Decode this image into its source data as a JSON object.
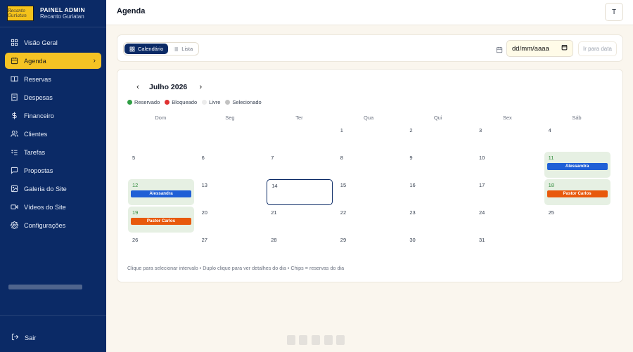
{
  "brand": {
    "logo_text": "Recanto Guriatan",
    "title": "PAINEL ADMIN",
    "subtitle": "Recanto Guriatan"
  },
  "sidebar": {
    "items": [
      {
        "label": "Visão Geral",
        "icon": "grid-icon",
        "active": false
      },
      {
        "label": "Agenda",
        "icon": "calendar-icon",
        "active": true
      },
      {
        "label": "Reservas",
        "icon": "book-icon",
        "active": false
      },
      {
        "label": "Despesas",
        "icon": "receipt-icon",
        "active": false
      },
      {
        "label": "Financeiro",
        "icon": "dollar-icon",
        "active": false
      },
      {
        "label": "Clientes",
        "icon": "users-icon",
        "active": false
      },
      {
        "label": "Tarefas",
        "icon": "checklist-icon",
        "active": false
      },
      {
        "label": "Propostas",
        "icon": "message-icon",
        "active": false
      },
      {
        "label": "Galeria do Site",
        "icon": "image-icon",
        "active": false
      },
      {
        "label": "Vídeos do Site",
        "icon": "video-icon",
        "active": false
      },
      {
        "label": "Configurações",
        "icon": "gear-icon",
        "active": false
      }
    ],
    "logout_label": "Sair"
  },
  "header": {
    "title": "Agenda",
    "theme_button": "T"
  },
  "toolbar": {
    "view_calendar": "Calendário",
    "view_list": "Lista",
    "date_value": "dd/mm/aaaa",
    "go_label": "Ir para data"
  },
  "calendar": {
    "month_label": "Julho 2026",
    "legend": [
      {
        "label": "Reservado",
        "color": "#2f9e44"
      },
      {
        "label": "Bloqueado",
        "color": "#e03131"
      },
      {
        "label": "Livre",
        "color": "#ececec"
      },
      {
        "label": "Selecionado",
        "color": "#c2c2c2"
      }
    ],
    "weekdays": [
      "Dom",
      "Seg",
      "Ter",
      "Qua",
      "Qui",
      "Sex",
      "Sáb"
    ],
    "weeks": [
      [
        "",
        "",
        "",
        "1",
        "2",
        "3",
        "4"
      ],
      [
        "5",
        "6",
        "7",
        "8",
        "9",
        "10",
        "11"
      ],
      [
        "12",
        "13",
        "14",
        "15",
        "16",
        "17",
        "18"
      ],
      [
        "19",
        "20",
        "21",
        "22",
        "23",
        "24",
        "25"
      ],
      [
        "26",
        "27",
        "28",
        "29",
        "30",
        "31",
        ""
      ]
    ],
    "bookings": [
      {
        "day": "11",
        "name": "Alessandra",
        "color": "#1f5fd6"
      },
      {
        "day": "12",
        "name": "Alessandra",
        "color": "#1f5fd6"
      },
      {
        "day": "18",
        "name": "Pastor Carlos",
        "color": "#e8590c"
      },
      {
        "day": "19",
        "name": "Pastor Carlos",
        "color": "#e8590c"
      }
    ],
    "selected_day": "14",
    "hint": "Clique para selecionar intervalo • Duplo clique para ver detalhes do dia • Chips = reservas do dia"
  },
  "colors": {
    "sidebar_bg": "#0b2a66",
    "accent": "#f5c324",
    "page_bg": "#faf6ee"
  }
}
